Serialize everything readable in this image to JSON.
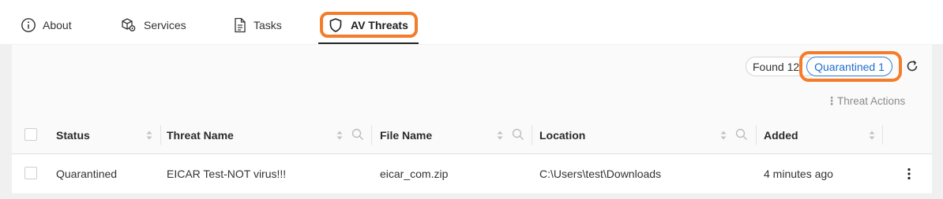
{
  "tabs": {
    "about": "About",
    "services": "Services",
    "tasks": "Tasks",
    "av_threats": "AV Threats",
    "active": "av_threats"
  },
  "summary": {
    "found": "Found 12",
    "quarantined": "Quarantined 1"
  },
  "actions": {
    "threat_actions": "Threat Actions"
  },
  "table": {
    "columns": [
      "Status",
      "Threat Name",
      "File Name",
      "Location",
      "Added"
    ],
    "rows": [
      {
        "status": "Quarantined",
        "threat_name": "EICAR Test-NOT virus!!!",
        "file_name": "eicar_com.zip",
        "location": "C:\\Users\\test\\Downloads",
        "added": "4 minutes ago"
      }
    ]
  },
  "colors": {
    "highlight": "#f47c2a",
    "accent": "#1f6fce"
  }
}
